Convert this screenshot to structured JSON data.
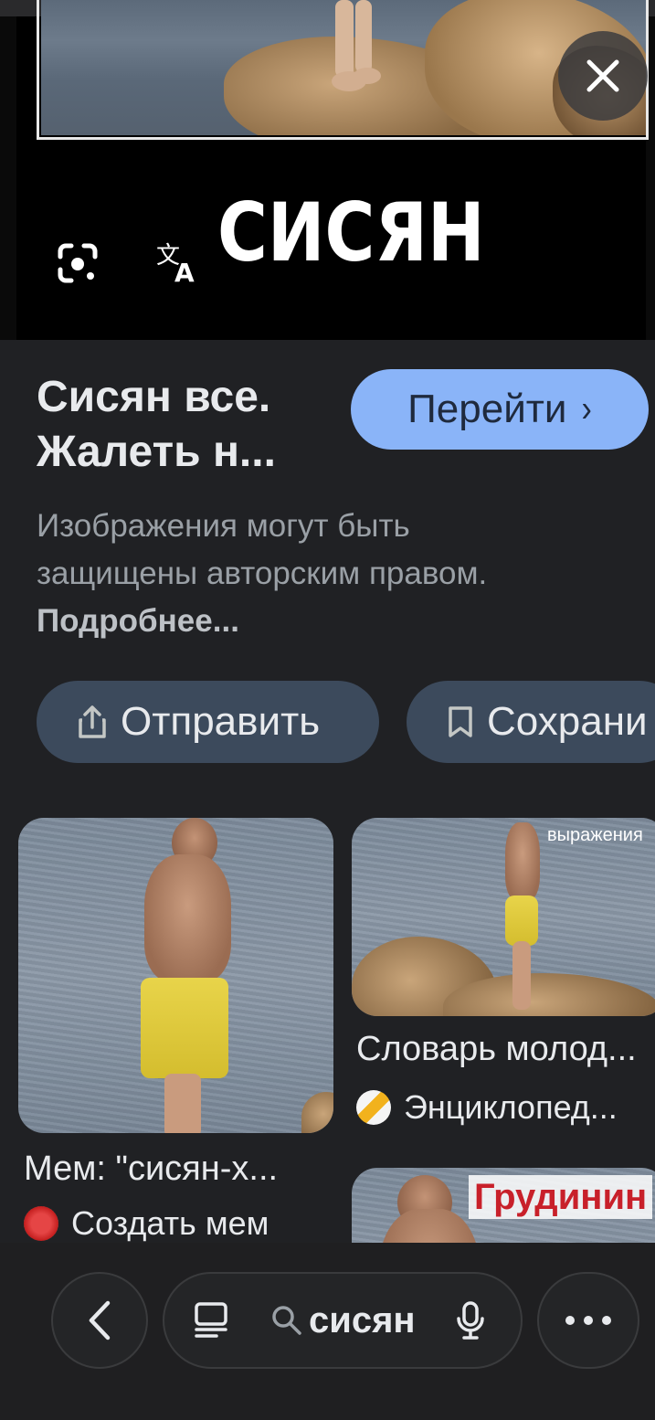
{
  "viewer": {
    "meme_caption": "СИСЯН",
    "close_icon": "close-icon",
    "lens_icon": "google-lens-icon",
    "translate_icon": "translate-icon"
  },
  "info": {
    "title_line1": "Сисян все.",
    "title_line2": "Жалеть н...",
    "goto_label": "Перейти",
    "copyright_text": "Изображения могут быть защищены авторским правом.",
    "copyright_link": "Подробнее...",
    "share_label": "Отправить",
    "save_label": "Сохрани"
  },
  "results": [
    {
      "title": "Мем: \"сисян-х...",
      "source": "Создать мем"
    },
    {
      "title": "Словарь молод...",
      "source": "Энциклопед...",
      "overlay_text": "выражения"
    },
    {
      "overlay_text": "Грудинин"
    }
  ],
  "bottom_nav": {
    "search_query": "сисян"
  },
  "colors": {
    "accent": "#8ab4f8",
    "panel": "#202124",
    "pill": "#3c4a5c"
  }
}
